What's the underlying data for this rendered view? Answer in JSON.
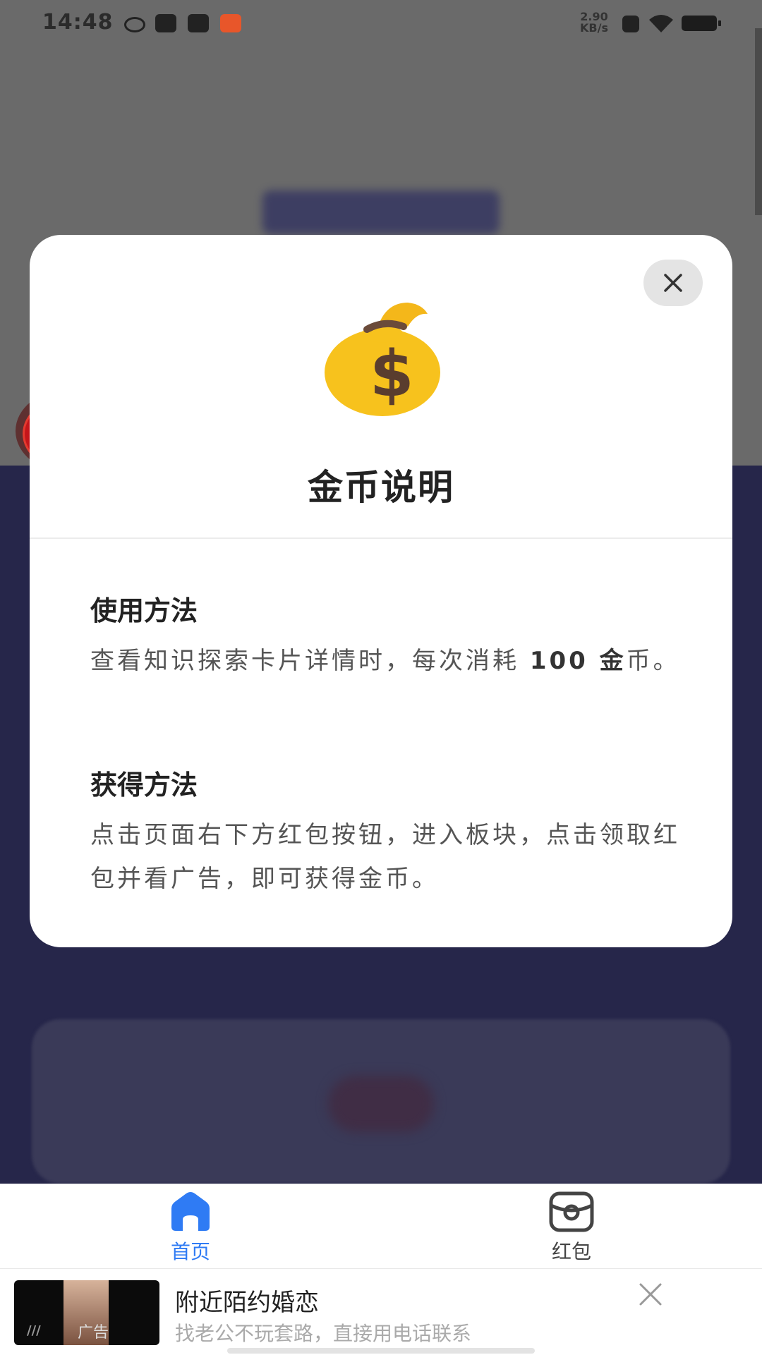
{
  "status_bar": {
    "time": "14:48",
    "net_speed_value": "2.90",
    "net_speed_unit": "KB/s"
  },
  "modal": {
    "title": "金币说明",
    "sections": [
      {
        "heading": "使用方法",
        "text_before": "查看知识探索卡片详情时，每次消耗 ",
        "text_bold": "100 金",
        "text_after": "币。"
      },
      {
        "heading": "获得方法",
        "text": "点击页面右下方红包按钮，进入板块，点击领取红包并看广告，即可获得金币。"
      }
    ]
  },
  "floating_button": {
    "coin_symbol": "¥"
  },
  "bottom_nav": {
    "items": [
      {
        "label": "首页",
        "icon": "home-icon",
        "active": true
      },
      {
        "label": "红包",
        "icon": "red-packet-icon",
        "active": false
      }
    ],
    "active_color": "#2f7bf4"
  },
  "ad": {
    "tag": "广告",
    "title": "附近陌约婚恋",
    "subtitle": "找老公不玩套路，直接用电话联系"
  }
}
